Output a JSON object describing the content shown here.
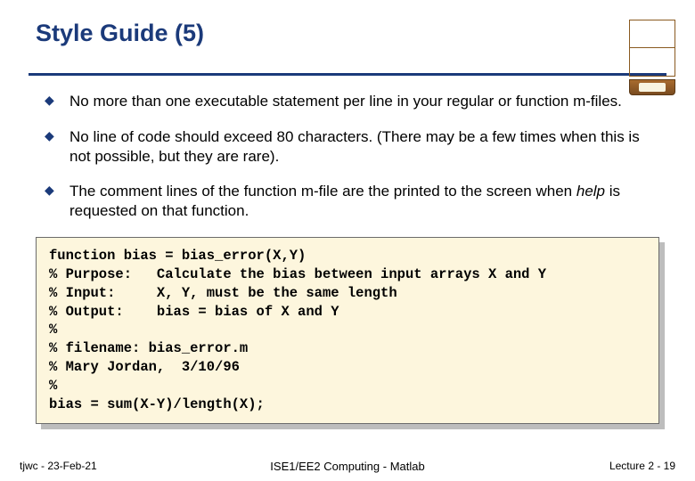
{
  "title": "Style Guide (5)",
  "bullets": [
    "No more than one executable statement per line in your regular or function m-files.",
    "No line of code should exceed 80 characters. (There may be a few times when this is not possible, but they are rare).",
    "The comment lines of the function m-file are the printed to the screen when __ITALIC_help__ is requested on that function."
  ],
  "code": "function bias = bias_error(X,Y)\n% Purpose:   Calculate the bias between input arrays X and Y\n% Input:     X, Y, must be the same length\n% Output:    bias = bias of X and Y\n%\n% filename: bias_error.m\n% Mary Jordan,  3/10/96\n%\nbias = sum(X-Y)/length(X);",
  "footer": {
    "left": "tjwc - 23-Feb-21",
    "center": "ISE1/EE2 Computing - Matlab",
    "right": "Lecture 2 - 19"
  }
}
